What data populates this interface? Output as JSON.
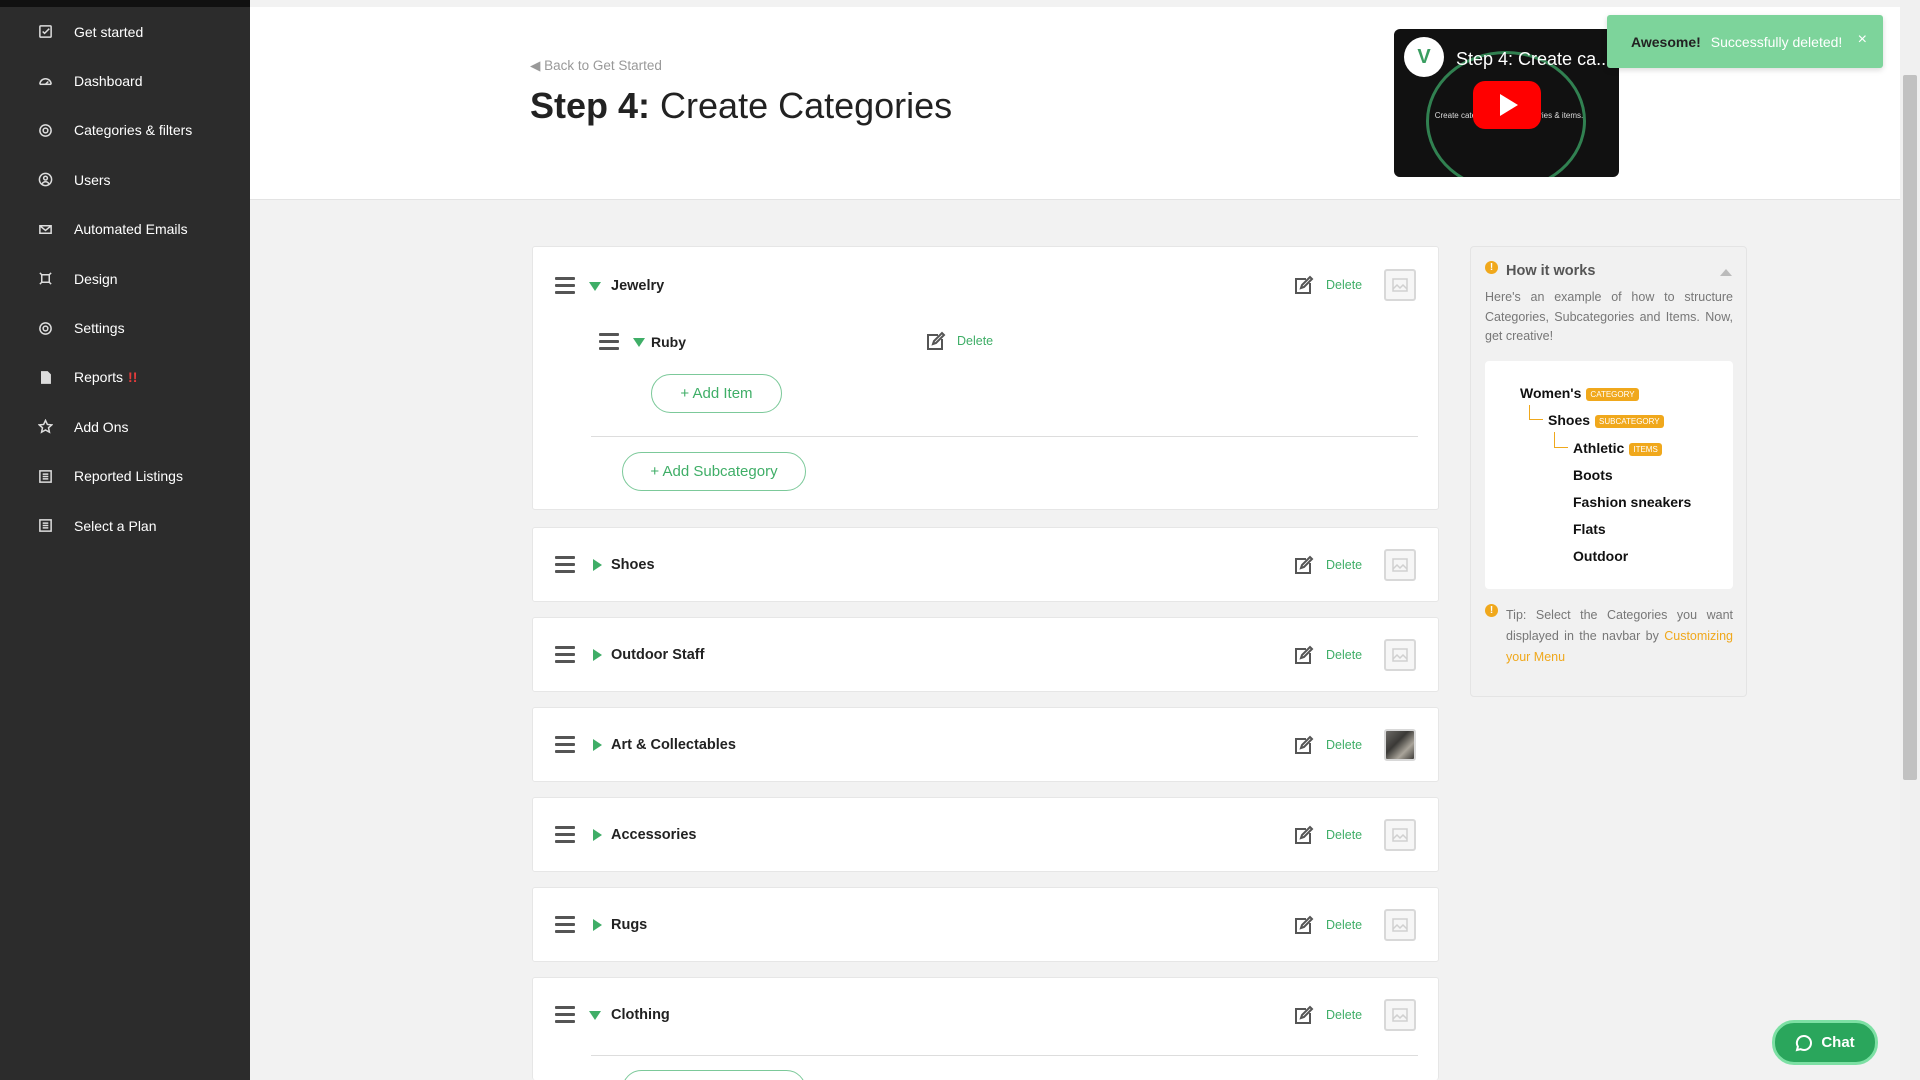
{
  "sidebar": {
    "items": [
      {
        "label": "Get started",
        "icon": "checkbox-icon"
      },
      {
        "label": "Dashboard",
        "icon": "dashboard-icon"
      },
      {
        "label": "Categories & filters",
        "icon": "target-icon"
      },
      {
        "label": "Users",
        "icon": "user-icon"
      },
      {
        "label": "Automated Emails",
        "icon": "mail-icon"
      },
      {
        "label": "Design",
        "icon": "design-icon"
      },
      {
        "label": "Settings",
        "icon": "settings-icon"
      },
      {
        "label": "Reports",
        "icon": "document-icon",
        "alert": "!!"
      },
      {
        "label": "Add Ons",
        "icon": "star-icon"
      },
      {
        "label": "Reported Listings",
        "icon": "list-icon"
      },
      {
        "label": "Select a Plan",
        "icon": "list-icon"
      }
    ]
  },
  "header": {
    "back_link": "◀ Back to Get Started",
    "title_step": "Step 4:",
    "title_text": " Create Categories",
    "video": {
      "title": "Step 4: Create ca...",
      "subtitle": "Create categories, subcategories & items."
    }
  },
  "toast": {
    "strong": "Awesome!",
    "message": "Successfully deleted!",
    "close": "×"
  },
  "categories": [
    {
      "name": "Jewelry",
      "expanded": true,
      "image": false,
      "subcategories": [
        {
          "name": "Ruby",
          "expanded": true
        }
      ]
    },
    {
      "name": "Shoes",
      "expanded": false,
      "image": false
    },
    {
      "name": "Outdoor Staff",
      "expanded": false,
      "image": false
    },
    {
      "name": "Art & Collectables",
      "expanded": false,
      "image": true
    },
    {
      "name": "Accessories",
      "expanded": false,
      "image": false
    },
    {
      "name": "Rugs",
      "expanded": false,
      "image": false
    },
    {
      "name": "Clothing",
      "expanded": true,
      "image": false
    }
  ],
  "labels": {
    "delete": "Delete",
    "add_item": "+ Add Item",
    "add_subcategory": "+ Add Subcategory"
  },
  "how_it_works": {
    "title": "How it works",
    "description": "Here's an example of how to structure Categories, Subcategories and Items. Now, get creative!",
    "example": {
      "category": "Women's",
      "category_badge": "CATEGORY",
      "subcategory": "Shoes",
      "subcategory_badge": "SUBCATEGORY",
      "items_badge": "ITEMS",
      "items": [
        "Athletic",
        "Boots",
        "Fashion sneakers",
        "Flats",
        "Outdoor"
      ]
    },
    "tip_text": "Tip: Select the Categories you want displayed in the navbar by ",
    "tip_link": "Customizing your Menu"
  },
  "chat": {
    "label": "Chat"
  },
  "colors": {
    "sidebar_bg": "#2c2c2c",
    "accent_green": "#3fae67",
    "toast_bg": "#7dd49b",
    "warning_orange": "#f0a81c"
  }
}
